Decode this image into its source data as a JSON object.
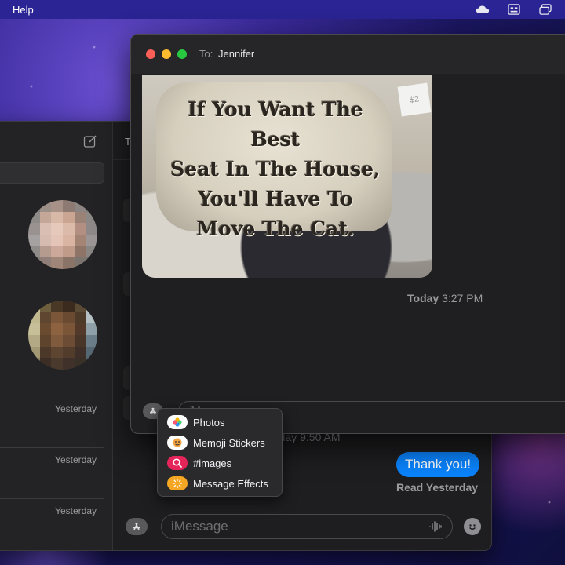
{
  "menubar": {
    "help_label": "Help"
  },
  "back_window": {
    "to_fragment": "T",
    "conversation_times": [
      "Yesterday",
      "Yesterday",
      "Yesterday"
    ],
    "timestamp_fragment": "rday 9:50 AM",
    "sent_message": "Thank you!",
    "read_receipt": "Read Yesterday",
    "input_placeholder": "iMessage"
  },
  "front_window": {
    "to_label": "To:",
    "recipient": "Jennifer",
    "photo": {
      "lines": [
        "If You Want The Best",
        "Seat In The House,",
        "You'll Have To",
        "Move The Cat."
      ],
      "price_tag": "$2"
    },
    "timestamp_day": "Today",
    "timestamp_time": "3:27 PM",
    "input_placeholder": "iMessage"
  },
  "app_menu": {
    "items": [
      {
        "label": "Photos",
        "icon": "photos-icon"
      },
      {
        "label": "Memoji Stickers",
        "icon": "memoji-icon"
      },
      {
        "label": "#images",
        "icon": "images-search-icon"
      },
      {
        "label": "Message Effects",
        "icon": "effects-icon"
      }
    ]
  },
  "colors": {
    "accent": "#0a84ff",
    "background": "#1f1f21"
  }
}
